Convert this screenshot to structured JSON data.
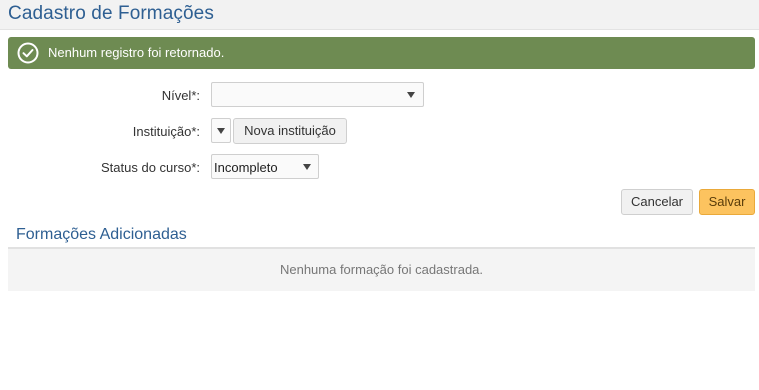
{
  "header": {
    "title": "Cadastro de Formações"
  },
  "alert": {
    "text": "Nenhum registro foi retornado.",
    "icon": "check-circle-icon",
    "color": "#6e8b52"
  },
  "form": {
    "nivel": {
      "label": "Nível*:",
      "value": ""
    },
    "instituicao": {
      "label": "Instituição*:",
      "value": "",
      "new_button_label": "Nova instituição"
    },
    "status": {
      "label": "Status do curso*:",
      "value": "Incompleto"
    }
  },
  "actions": {
    "cancel_label": "Cancelar",
    "save_label": "Salvar",
    "save_color": "#fcc35f"
  },
  "section": {
    "title": "Formações Adicionadas",
    "empty_text": "Nenhuma formação foi cadastrada."
  }
}
